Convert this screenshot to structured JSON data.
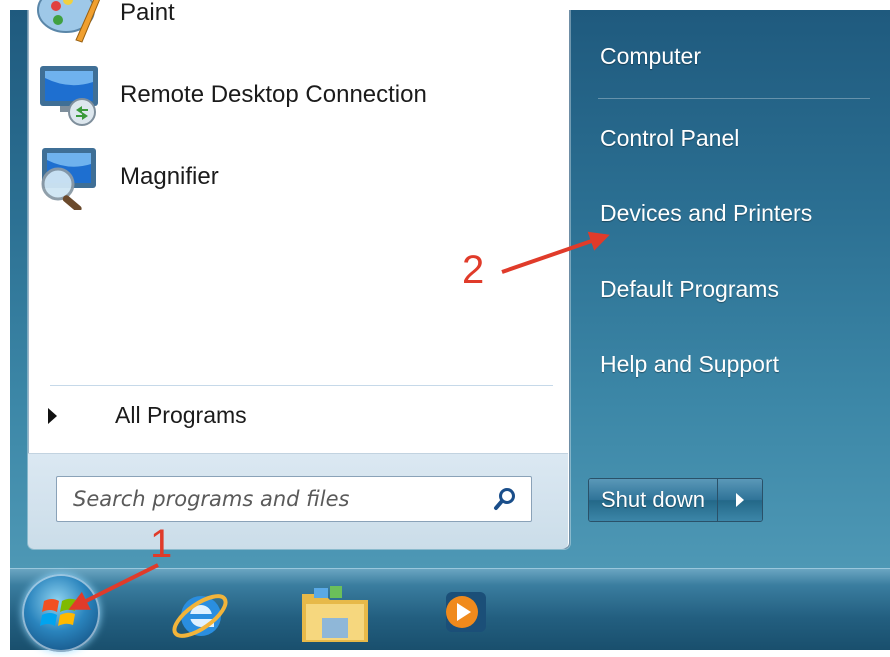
{
  "start_menu": {
    "programs": [
      {
        "label": "Paint",
        "icon": "paint-icon"
      },
      {
        "label": "Remote Desktop Connection",
        "icon": "remote-desktop-icon"
      },
      {
        "label": "Magnifier",
        "icon": "magnifier-icon"
      }
    ],
    "all_programs_label": "All Programs",
    "search_placeholder": "Search programs and files",
    "right_items": [
      {
        "label": "Computer"
      },
      {
        "label": "Control Panel"
      },
      {
        "label": "Devices and Printers"
      },
      {
        "label": "Default Programs"
      },
      {
        "label": "Help and Support"
      }
    ],
    "shutdown_label": "Shut down"
  },
  "taskbar": {
    "items": [
      {
        "icon": "windows-start-orb"
      },
      {
        "icon": "internet-explorer-icon"
      },
      {
        "icon": "windows-explorer-folder-icon"
      },
      {
        "icon": "media-player-icon"
      }
    ]
  },
  "annotations": {
    "step1": "1",
    "step2": "2",
    "color": "#e03b2a"
  }
}
